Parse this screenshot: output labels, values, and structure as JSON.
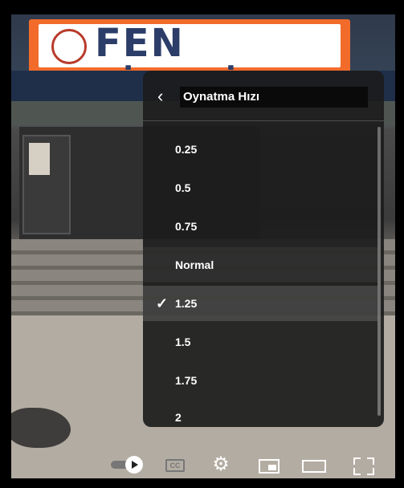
{
  "scene": {
    "sign_text": "FEN LİSESİ"
  },
  "settings_menu": {
    "title": "Oynatma Hızı",
    "back_icon": "chevron-left-icon",
    "options": [
      {
        "label": "0.25"
      },
      {
        "label": "0.5"
      },
      {
        "label": "0.75"
      },
      {
        "label": "Normal"
      },
      {
        "label": "1.25",
        "selected": true
      },
      {
        "label": "1.5"
      },
      {
        "label": "1.75"
      },
      {
        "label": "2"
      }
    ],
    "selected_marker": "✓"
  },
  "controls": {
    "autoplay_icon": "autoplay-toggle-icon",
    "cc_label": "CC",
    "settings_icon": "gear-icon",
    "miniplayer_icon": "miniplayer-icon",
    "theater_icon": "theater-mode-icon",
    "fullscreen_icon": "fullscreen-icon"
  },
  "colors": {
    "menu_bg": "#1c1c1c",
    "sign_orange": "#f26b2b",
    "sign_text": "#2b3d68"
  }
}
